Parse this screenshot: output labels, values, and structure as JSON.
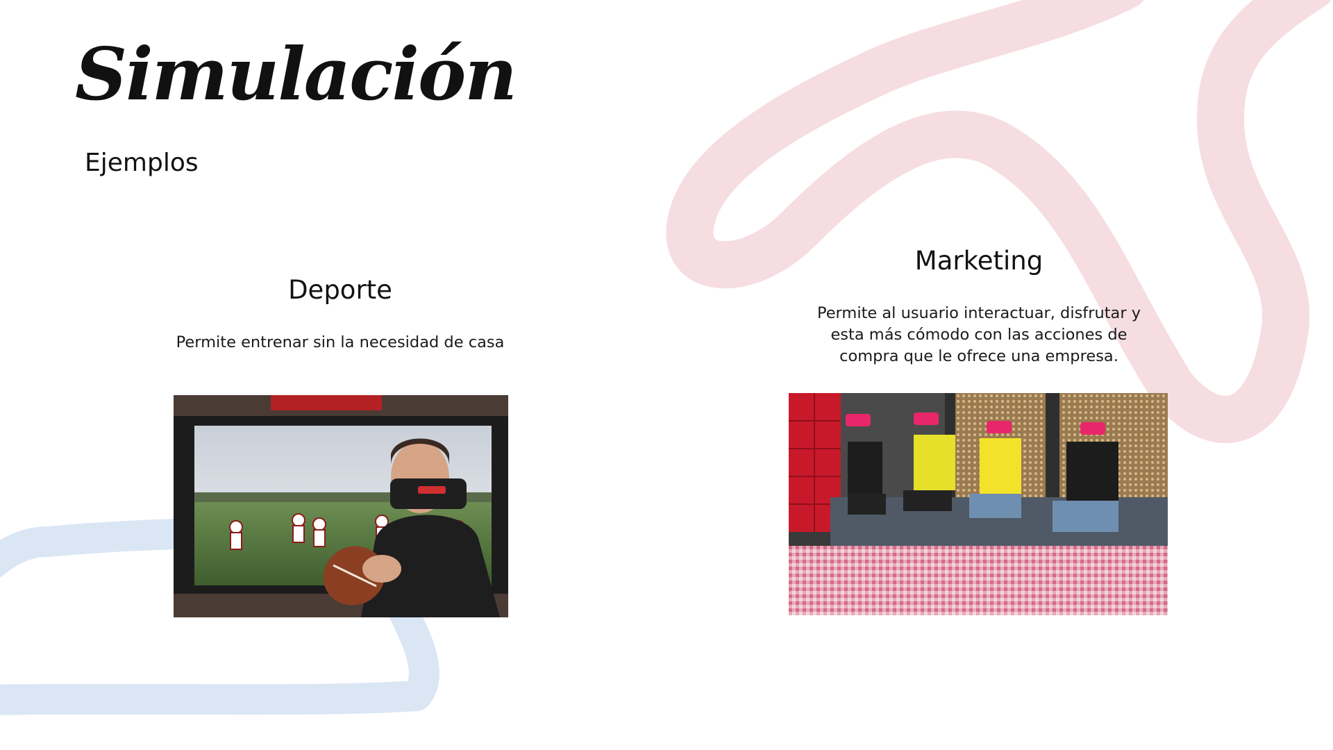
{
  "slide": {
    "title": "Simulación",
    "subtitle": "Ejemplos"
  },
  "examples": [
    {
      "heading": "Deporte",
      "description": "Permite entrenar sin la necesidad de casa"
    },
    {
      "heading": "Marketing",
      "description": "Permite al usuario interactuar, disfrutar y esta más cómodo con las acciones de compra que le ofrece una empresa."
    }
  ],
  "colors": {
    "pink_stroke": "#f6dde1",
    "blue_stroke": "#dbe6f5",
    "text": "#111111",
    "locker_red": "#c8192a",
    "headset_pink": "#e8276a"
  }
}
